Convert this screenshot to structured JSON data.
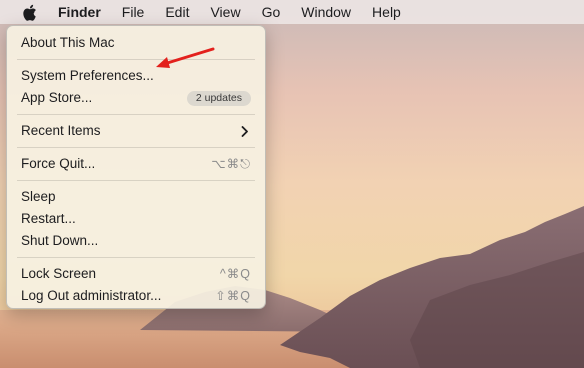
{
  "menubar": {
    "app_name": "Finder",
    "items": [
      "File",
      "Edit",
      "View",
      "Go",
      "Window",
      "Help"
    ]
  },
  "apple_menu": {
    "about": "About This Mac",
    "system_preferences": "System Preferences...",
    "app_store": "App Store...",
    "app_store_badge": "2 updates",
    "recent_items": "Recent Items",
    "force_quit": "Force Quit...",
    "force_quit_shortcut": "⌥⌘⎋",
    "sleep": "Sleep",
    "restart": "Restart...",
    "shut_down": "Shut Down...",
    "lock_screen": "Lock Screen",
    "lock_screen_shortcut": "^⌘Q",
    "log_out": "Log Out administrator...",
    "log_out_shortcut": "⇧⌘Q"
  },
  "colors": {
    "annotation_arrow": "#e3211d"
  }
}
